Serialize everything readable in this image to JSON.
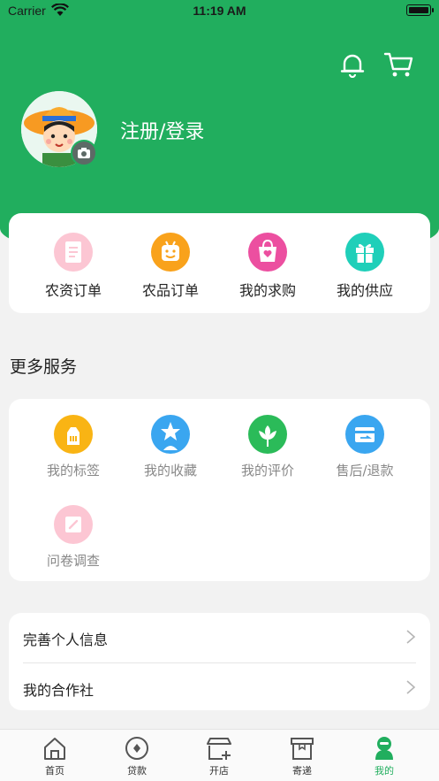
{
  "status_bar": {
    "carrier": "Carrier",
    "time": "11:19 AM"
  },
  "header": {
    "login_label": "注册/登录"
  },
  "orders": [
    {
      "label": "农资订单",
      "icon": "document-icon",
      "color": "#fcc6d3"
    },
    {
      "label": "农品订单",
      "icon": "smile-bag-icon",
      "color": "#f9a21b"
    },
    {
      "label": "我的求购",
      "icon": "shopping-bag-icon",
      "color": "#ec4fa0"
    },
    {
      "label": "我的供应",
      "icon": "gift-icon",
      "color": "#1fcfb9"
    }
  ],
  "more_services": {
    "title": "更多服务",
    "items": [
      {
        "label": "我的标签",
        "icon": "tag-icon",
        "color": "#f9b414"
      },
      {
        "label": "我的收藏",
        "icon": "star-person-icon",
        "color": "#3aa6f0"
      },
      {
        "label": "我的评价",
        "icon": "leaf-icon",
        "color": "#2bbb59"
      },
      {
        "label": "售后/退款",
        "icon": "refund-icon",
        "color": "#3aa6f0"
      },
      {
        "label": "问卷调查",
        "icon": "survey-icon",
        "color": "#fcc6d3"
      }
    ]
  },
  "settings": [
    {
      "label": "完善个人信息"
    },
    {
      "label": "我的合作社"
    }
  ],
  "tabbar": [
    {
      "label": "首页",
      "icon": "home-icon"
    },
    {
      "label": "贷款",
      "icon": "loan-icon"
    },
    {
      "label": "开店",
      "icon": "shop-icon"
    },
    {
      "label": "寄递",
      "icon": "delivery-icon"
    },
    {
      "label": "我的",
      "icon": "profile-icon",
      "active": true
    }
  ],
  "colors": {
    "brand": "#21ae5e",
    "background": "#f2f2f2"
  }
}
